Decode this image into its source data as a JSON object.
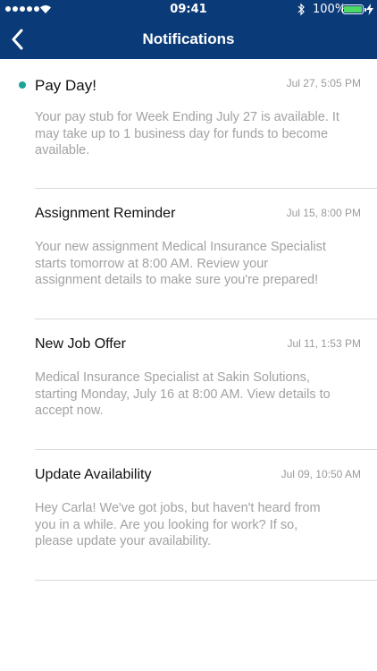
{
  "status_bar": {
    "time": "09:41",
    "battery_percent": "100%",
    "battery_level": 1.0,
    "icons": [
      "signal-dots-icon",
      "wifi-icon",
      "bluetooth-icon",
      "battery-icon",
      "charging-bolt-icon"
    ]
  },
  "nav": {
    "title": "Notifications",
    "back_icon": "chevron-left-icon"
  },
  "colors": {
    "nav_background": "#0b3a78",
    "unread_dot": "#1aa59a",
    "body_text": "#a2a2a2",
    "date_text": "#9a9a9a",
    "divider": "#d9d9d9"
  },
  "notifications": [
    {
      "title": "Pay Day!",
      "date": "Jul 27, 5:05 PM",
      "body": "Your pay stub for Week Ending July 27 is available. It\nmay take up to 1 business day for funds to become\navailable.",
      "unread": true
    },
    {
      "title": "Assignment Reminder",
      "date": "Jul 15, 8:00 PM",
      "body": "Your new assignment Medical Insurance Specialist\nstarts tomorrow at 8:00 AM.  Review your\nassignment details to make sure you're prepared!",
      "unread": false
    },
    {
      "title": "New Job Offer",
      "date": "Jul 11, 1:53 PM",
      "body": "Medical Insurance Specialist at Sakin Solutions,\nstarting Monday, July 16 at 8:00 AM.  View details to\naccept now.",
      "unread": false
    },
    {
      "title": "Update Availability",
      "date": "Jul 09, 10:50 AM",
      "body": "Hey Carla!  We've got jobs, but haven't heard from\nyou in a while.  Are you looking for work?  If so,\nplease update your availability.",
      "unread": false
    }
  ]
}
